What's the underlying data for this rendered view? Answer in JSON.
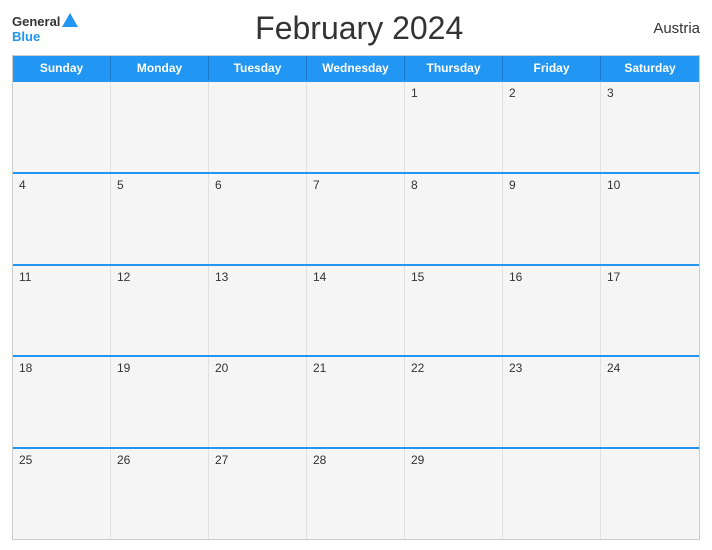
{
  "header": {
    "logo_general": "General",
    "logo_blue": "Blue",
    "title": "February 2024",
    "country": "Austria"
  },
  "calendar": {
    "days_of_week": [
      "Sunday",
      "Monday",
      "Tuesday",
      "Wednesday",
      "Thursday",
      "Friday",
      "Saturday"
    ],
    "weeks": [
      [
        "",
        "",
        "",
        "",
        "1",
        "2",
        "3"
      ],
      [
        "4",
        "5",
        "6",
        "7",
        "8",
        "9",
        "10"
      ],
      [
        "11",
        "12",
        "13",
        "14",
        "15",
        "16",
        "17"
      ],
      [
        "18",
        "19",
        "20",
        "21",
        "22",
        "23",
        "24"
      ],
      [
        "25",
        "26",
        "27",
        "28",
        "29",
        "",
        ""
      ]
    ]
  }
}
